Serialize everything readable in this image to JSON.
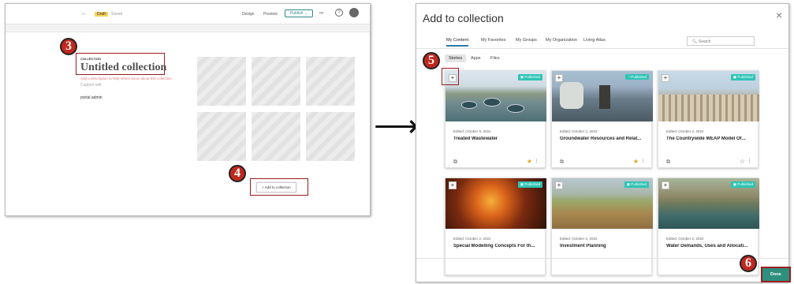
{
  "left_screen": {
    "topbar": {
      "back": "←",
      "draft_badge": "Draft",
      "status": "Saved",
      "design": "Design",
      "preview": "Preview",
      "publish": "Publish",
      "more": "•••",
      "help": "?"
    },
    "collection_label": "COLLECTION",
    "collection_title": "Untitled collection",
    "description_placeholder": "Add a description to help others know about this collection",
    "caption_placeholder": "Caption edit",
    "author": "portal admin",
    "add_to_collection": "+ Add to collection"
  },
  "arrow": "⟶",
  "dialog": {
    "title": "Add to collection",
    "close": "×",
    "tabs": [
      "My Content",
      "My Favorites",
      "My Groups",
      "My Organization",
      "Living Atlas"
    ],
    "active_tab": 0,
    "search_placeholder": "Search",
    "filter_tabs": [
      "Stories",
      "Apps",
      "Files"
    ],
    "active_filter": 0,
    "cards": [
      {
        "edited": "Edited: October 9, 2022",
        "title": "Treated Wastewater",
        "status": "Published",
        "favorite": true
      },
      {
        "edited": "Edited: October 2, 2022",
        "title": "Groundwater Resources and Relat...",
        "status": "Published",
        "favorite": true
      },
      {
        "edited": "Edited: October 2, 2022",
        "title": "The Countrywide WEAP Model Of...",
        "status": "Published",
        "favorite": false
      },
      {
        "edited": "Edited: October 2, 2022",
        "title": "Special Modelling Concepts For th...",
        "status": "Published",
        "favorite": false
      },
      {
        "edited": "Edited: October 2, 2022",
        "title": "Investment Planning",
        "status": "Published",
        "favorite": false
      },
      {
        "edited": "Edited: October 2, 2022",
        "title": "Water Demands, Uses and Allocati...",
        "status": "Published",
        "favorite": false
      }
    ],
    "done": "Done"
  },
  "step_badges": [
    "3",
    "4",
    "5",
    "6"
  ],
  "colors": {
    "accent": "#2f8f7f",
    "published": "#2ec4b6",
    "highlight_box": "#9b1c1c",
    "badge": "#c0281f"
  }
}
